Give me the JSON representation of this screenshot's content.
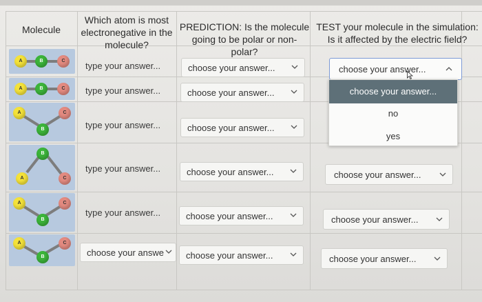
{
  "headers": {
    "molecule": "Molecule",
    "electroneg": "Which atom is most electronegative in the molecule?",
    "prediction": "PREDICTION: Is the molecule going to be polar or non-polar?",
    "test": "TEST your molecule in the simulation: Is it affected by the electric field?"
  },
  "atoms": {
    "a": "A",
    "b": "B",
    "c": "C"
  },
  "rows": [
    {
      "answer": "type your answer...",
      "prediction": "choose your answer...",
      "test": "choose your answer..."
    },
    {
      "answer": "type your answer...",
      "prediction": "choose your answer...",
      "test": ""
    },
    {
      "answer": "type your answer...",
      "prediction": "choose your answer...",
      "test": ""
    },
    {
      "answer": "type your answer...",
      "prediction": "choose your answer...",
      "test": "choose your answer..."
    },
    {
      "answer": "type your answer...",
      "prediction": "choose your answer...",
      "test": "choose your answer..."
    },
    {
      "answer": "choose your answe",
      "prediction": "choose your answer...",
      "test": "choose your answer..."
    }
  ],
  "dropdown": {
    "highlighted": "choose your answer...",
    "options": [
      "no",
      "yes"
    ]
  }
}
